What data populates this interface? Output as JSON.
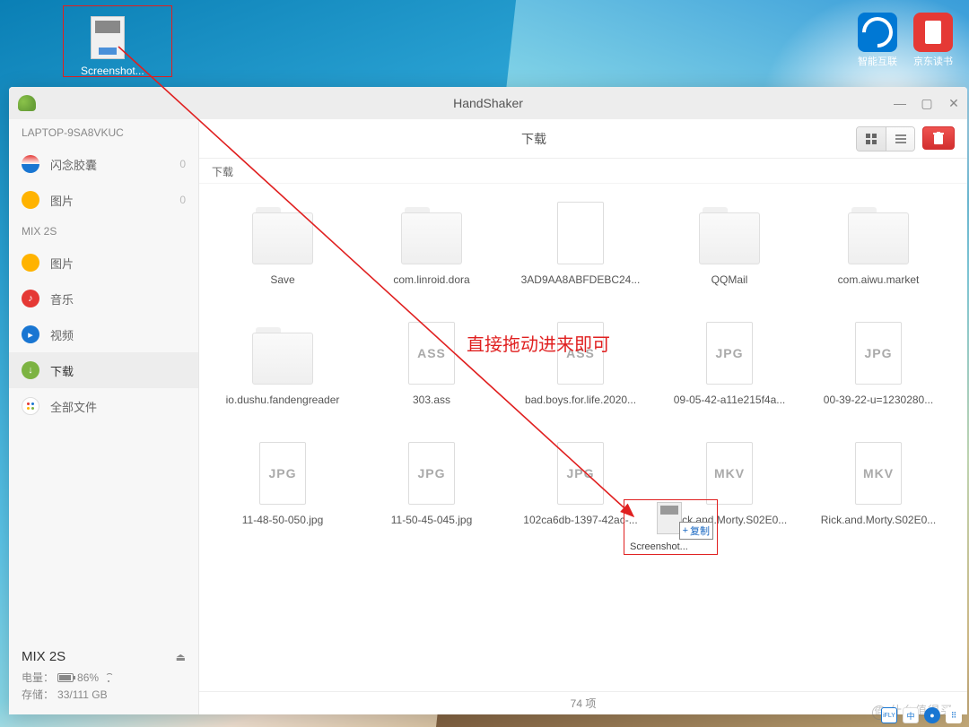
{
  "desktop": {
    "screenshot_icon_label": "Screenshot...",
    "dock": [
      {
        "label": "智能互联"
      },
      {
        "label": "京东读书"
      }
    ]
  },
  "annot": {
    "text": "直接拖动进来即可",
    "copy_badge": "复制",
    "ghost_label": "Screenshot..."
  },
  "app": {
    "title": "HandShaker",
    "sidebar": {
      "header1": "LAPTOP-9SA8VKUC",
      "items1": [
        {
          "label": "闪念胶囊",
          "count": "0"
        },
        {
          "label": "图片",
          "count": "0"
        }
      ],
      "header2": "MIX 2S",
      "items2": [
        {
          "label": "图片"
        },
        {
          "label": "音乐"
        },
        {
          "label": "视频"
        },
        {
          "label": "下载"
        },
        {
          "label": "全部文件"
        }
      ],
      "device": "MIX 2S",
      "battery_label": "电量：",
      "battery_pct": "86%",
      "storage_label": "存储：",
      "storage_val": "33/111 GB"
    },
    "content": {
      "title": "下载",
      "breadcrumb": "下载",
      "files": [
        {
          "name": "Save",
          "type": "folder"
        },
        {
          "name": "com.linroid.dora",
          "type": "folder"
        },
        {
          "name": "3AD9AA8ABFDEBC24...",
          "type": "file",
          "ext": ""
        },
        {
          "name": "QQMail",
          "type": "folder"
        },
        {
          "name": "com.aiwu.market",
          "type": "folder"
        },
        {
          "name": "io.dushu.fandengreader",
          "type": "folder"
        },
        {
          "name": "303.ass",
          "type": "file",
          "ext": "ASS"
        },
        {
          "name": "bad.boys.for.life.2020...",
          "type": "file",
          "ext": "ASS"
        },
        {
          "name": "09-05-42-a11e215f4a...",
          "type": "file",
          "ext": "JPG"
        },
        {
          "name": "00-39-22-u=1230280...",
          "type": "file",
          "ext": "JPG"
        },
        {
          "name": "11-48-50-050.jpg",
          "type": "file",
          "ext": "JPG"
        },
        {
          "name": "11-50-45-045.jpg",
          "type": "file",
          "ext": "JPG"
        },
        {
          "name": "102ca6db-1397-42ac-...",
          "type": "file",
          "ext": "JPG"
        },
        {
          "name": "Rick.and.Morty.S02E0...",
          "type": "file",
          "ext": "MKV"
        },
        {
          "name": "Rick.and.Morty.S02E0...",
          "type": "file",
          "ext": "MKV"
        }
      ],
      "footer": "74 项"
    }
  },
  "watermark": "什么值得买"
}
